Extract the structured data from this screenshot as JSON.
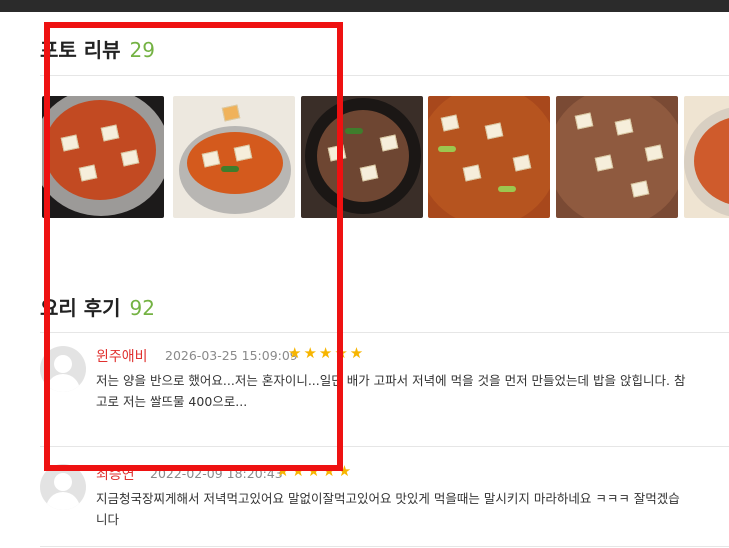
{
  "photo_review": {
    "title": "포토 리뷰",
    "count": "29"
  },
  "cook_review": {
    "title": "요리 후기",
    "count": "92"
  },
  "photos": [
    {
      "name": "stew-photo-1"
    },
    {
      "name": "stew-photo-2"
    },
    {
      "name": "stew-photo-3"
    },
    {
      "name": "stew-photo-4"
    },
    {
      "name": "stew-photo-5"
    },
    {
      "name": "stew-photo-6"
    }
  ],
  "reviews": [
    {
      "author": "윈주애비",
      "date": "2026-03-25 15:09:09",
      "stars": "★★★★★",
      "rating": 5,
      "text": "저는 양을 반으로 했어요...저는 혼자이니...일단 배가 고파서 저녁에 먹을 것을 먼저 만들었는데 밥을 앉힙니다. 참고로 저는 쌀뜨물 400으로..."
    },
    {
      "author": "최승연",
      "date": "2022-02-09 18:20:43",
      "stars": "★★★★★",
      "rating": 5,
      "text": "지금청국장찌게해서 저녁먹고있어요 말없이잘먹고있어요 맛있게 먹을때는 말시키지 마라하네요 ㅋㅋㅋ 잘먹겠습니다"
    }
  ],
  "colors": {
    "accent_count": "#74b243",
    "author": "#e0312f",
    "stars": "#f7b500",
    "highlight": "#ee1111"
  }
}
